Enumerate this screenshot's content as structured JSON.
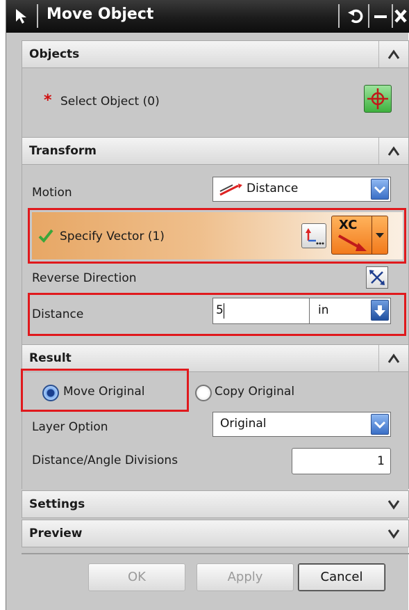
{
  "window": {
    "title": "Move Object"
  },
  "sections": {
    "objects": {
      "label": "Objects",
      "select_object_label": "Select Object (0)",
      "required_mark": "*"
    },
    "transform": {
      "label": "Transform",
      "motion_label": "Motion",
      "motion_value": "Distance",
      "specify_vector_label": "Specify Vector (1)",
      "vector_type": "XC",
      "reverse_direction_label": "Reverse Direction",
      "distance_label": "Distance",
      "distance_value": "5",
      "distance_unit": "in"
    },
    "result": {
      "label": "Result",
      "move_original_label": "Move Original",
      "copy_original_label": "Copy Original",
      "selected_option": "Move Original",
      "layer_option_label": "Layer Option",
      "layer_option_value": "Original",
      "divisions_label": "Distance/Angle Divisions",
      "divisions_value": "1"
    },
    "settings": {
      "label": "Settings"
    },
    "preview": {
      "label": "Preview"
    }
  },
  "buttons": {
    "ok": "OK",
    "apply": "Apply",
    "cancel": "Cancel"
  },
  "colors": {
    "highlight": "#e0191d",
    "dropdown_blue": "#3a6fc6",
    "check_green": "#3aa63a",
    "required_red": "#d01010"
  }
}
